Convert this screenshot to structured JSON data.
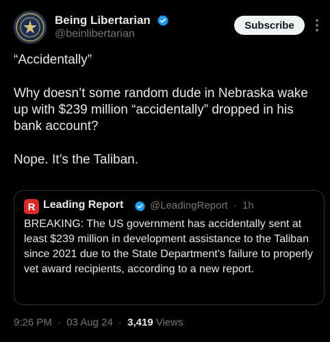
{
  "author": {
    "name": "Being Libertarian",
    "handle": "@beinlibertarian",
    "verified": true,
    "avatar_icon": "libertarian-seal-avatar"
  },
  "actions": {
    "subscribe_label": "Subscribe",
    "more_icon": "more-vertical-icon"
  },
  "tweet": {
    "paragraphs": [
      "“Accidentally”",
      "Why doesn’t some random dude in Nebraska wake up with $239 million “accidentally” dropped in his bank account?",
      "Nope. It’s the Taliban."
    ]
  },
  "quote": {
    "author_name": "Leading Report",
    "author_handle": "@LeadingReport",
    "time_ago": "1h",
    "meta_separator": "·",
    "verified": true,
    "avatar_icon": "leading-report-logo",
    "text": "BREAKING: The US government has accidentally sent at least $239 million in development assistance to the Taliban since 2021 due to the State Department's failure to properly vet award recipients, according to a new report."
  },
  "footer": {
    "time": "9:26 PM",
    "date": "03 Aug 24",
    "views_count": "3,419",
    "views_label": "Views",
    "separator": "·"
  },
  "colors": {
    "background": "#000000",
    "text": "#e7e9ea",
    "muted": "#71767b",
    "verified": "#1d9bf0",
    "border": "#2f3336",
    "quote_logo": "#d92b2b"
  }
}
